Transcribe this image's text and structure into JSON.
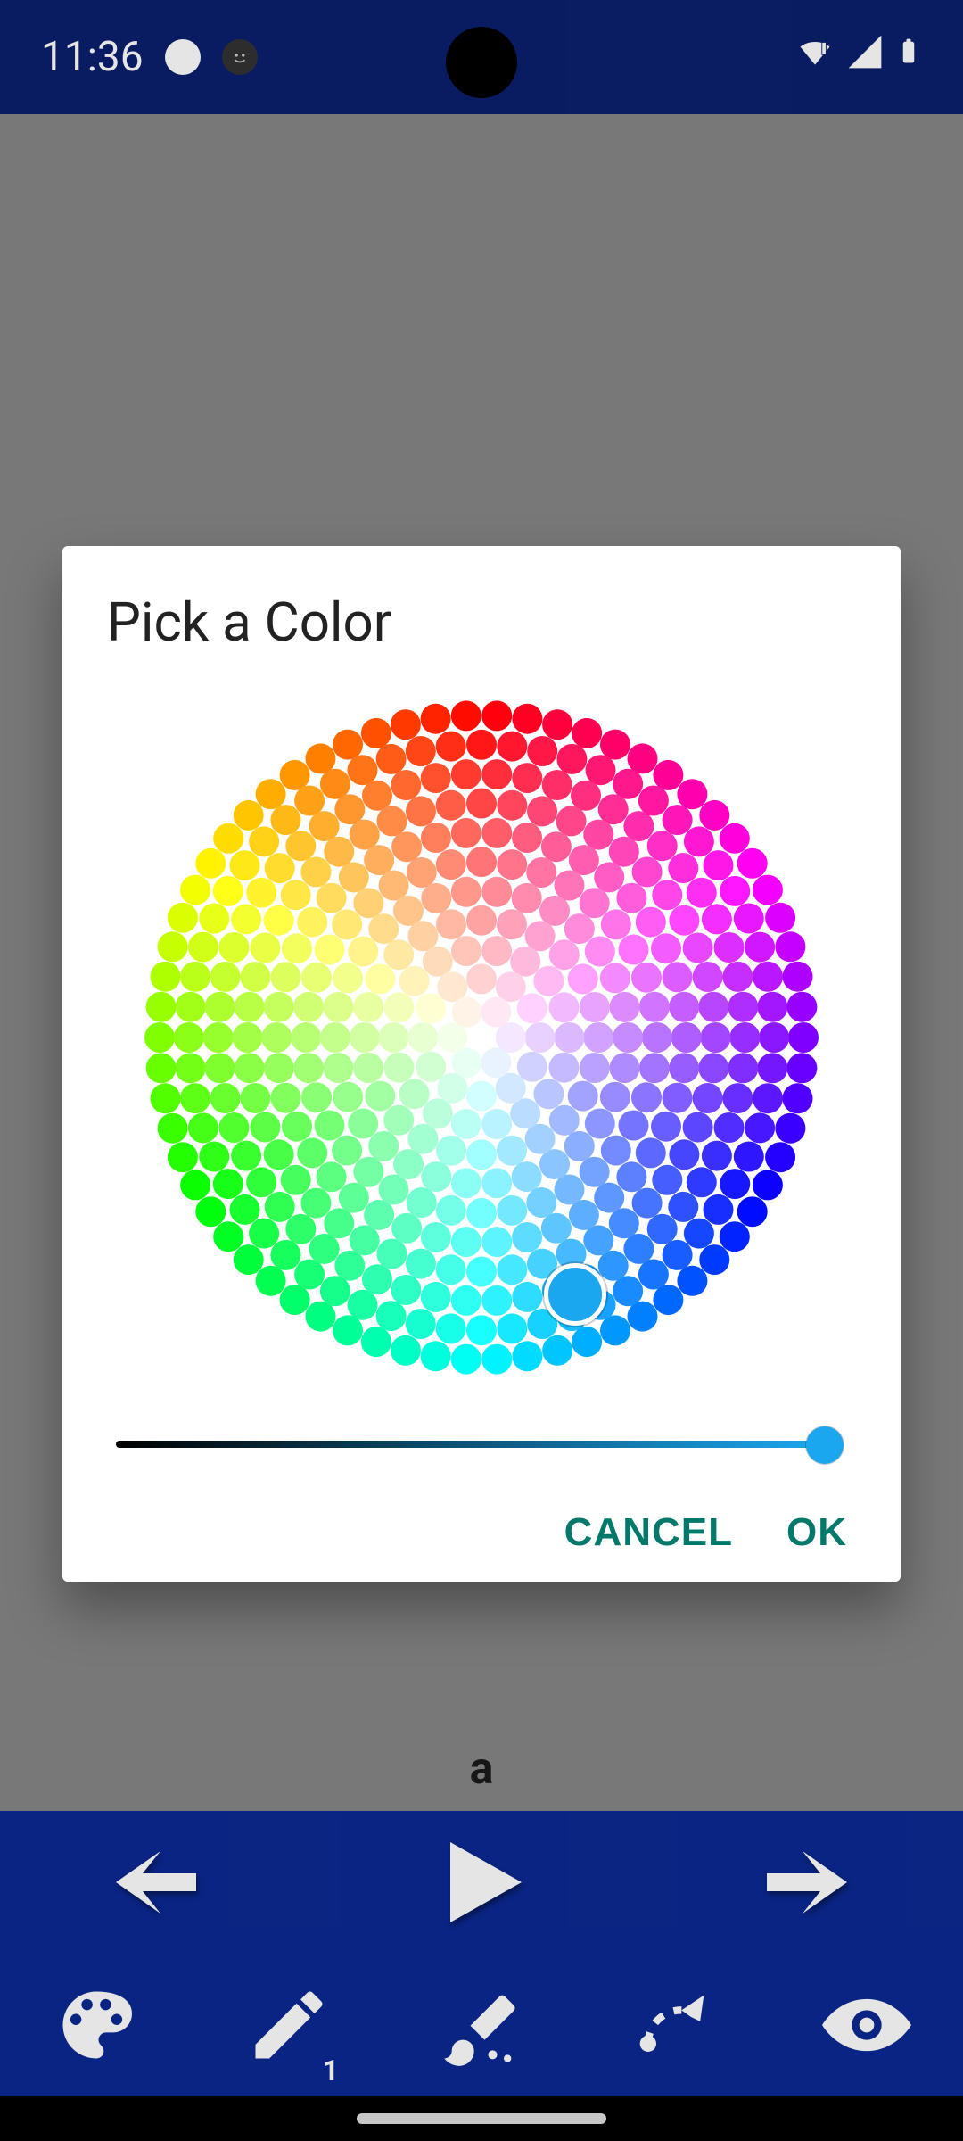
{
  "statusbar": {
    "time": "11:36"
  },
  "canvas": {
    "label": "a"
  },
  "dialog": {
    "title": "Pick a Color",
    "selected_color": "#1aa7ef",
    "selected_hue_deg": 200,
    "selected_sat_pct": 85,
    "brightness_pct": 97,
    "cancel_label": "CANCEL",
    "ok_label": "OK"
  },
  "playback": {
    "items": [
      "prev-icon",
      "play-icon",
      "next-icon"
    ]
  },
  "toolbar": {
    "items": [
      "palette-icon",
      "pen-icon",
      "brush-icon",
      "dashed-path-icon",
      "eye-icon"
    ],
    "pen_number": "1"
  }
}
